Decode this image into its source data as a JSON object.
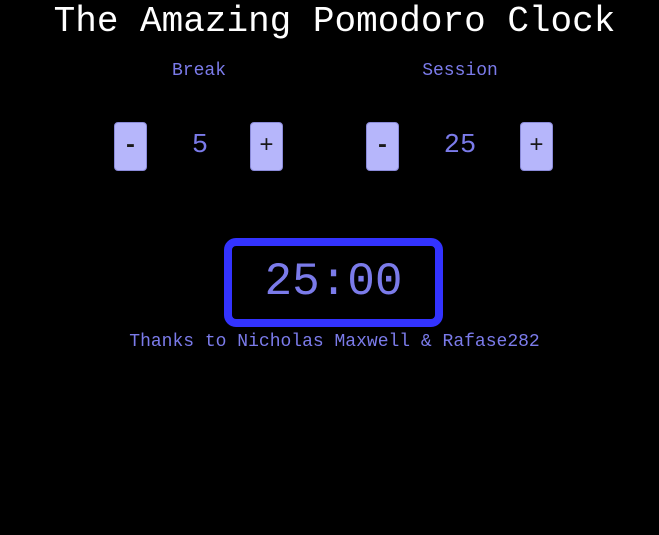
{
  "app": {
    "title": "The Amazing Pomodoro Clock"
  },
  "controls": {
    "break": {
      "label": "Break",
      "value": "5",
      "decrement_label": "-",
      "increment_label": "+"
    },
    "session": {
      "label": "Session",
      "value": "25",
      "decrement_label": "-",
      "increment_label": "+"
    }
  },
  "timer": {
    "display": "25:00"
  },
  "footer": {
    "credits": "Thanks to Nicholas Maxwell & Rafase282"
  },
  "colors": {
    "background": "#000000",
    "title": "#ffffff",
    "accent_text": "#7b7bea",
    "button_fill": "#b6b6fb",
    "timer_border": "#3333ff"
  }
}
